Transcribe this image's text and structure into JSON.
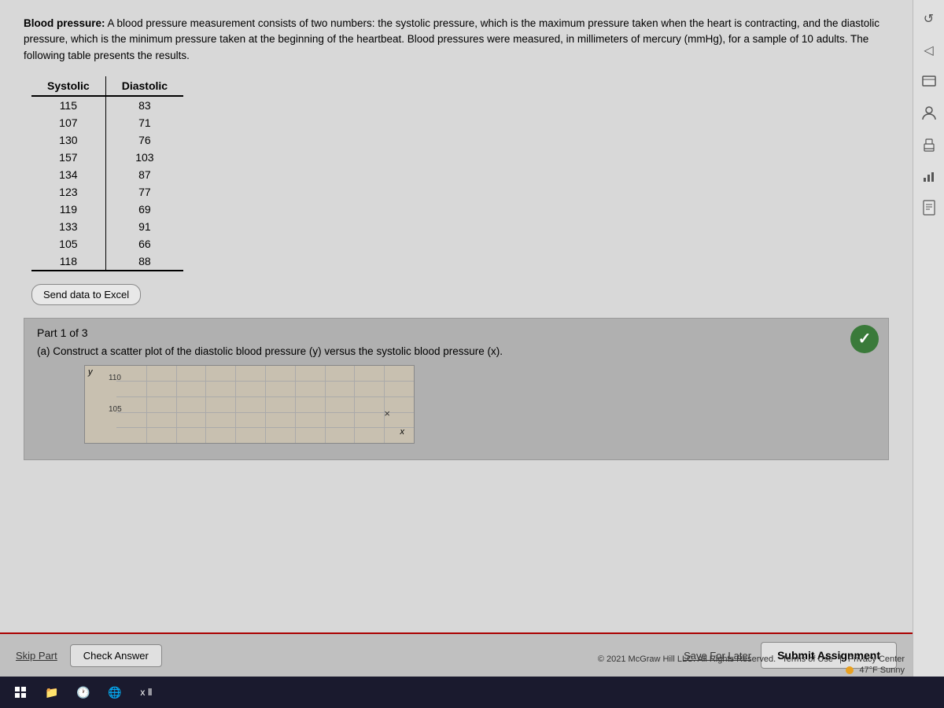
{
  "problem": {
    "intro_bold": "Blood pressure:",
    "intro_text": " A blood pressure measurement consists of two numbers: the systolic pressure, which is the maximum pressure taken when the heart is contracting, and the diastolic pressure, which is the minimum pressure taken at the beginning of the heartbeat. Blood pressures were measured, in millimeters of mercury (mmHg), for a sample of 10 adults. The following table presents the results."
  },
  "table": {
    "headers": [
      "Systolic",
      "Diastolic"
    ],
    "rows": [
      [
        "115",
        "83"
      ],
      [
        "107",
        "71"
      ],
      [
        "130",
        "76"
      ],
      [
        "157",
        "103"
      ],
      [
        "134",
        "87"
      ],
      [
        "123",
        "77"
      ],
      [
        "119",
        "69"
      ],
      [
        "133",
        "91"
      ],
      [
        "105",
        "66"
      ],
      [
        "118",
        "88"
      ]
    ]
  },
  "buttons": {
    "excel": "Send data to Excel",
    "skip_part": "Skip Part",
    "check_answer": "Check Answer",
    "save_later": "Save For Later",
    "submit": "Submit Assignment"
  },
  "part": {
    "label": "Part 1 of 3",
    "question": "(a) Construct a scatter plot of the diastolic blood pressure (y) versus the systolic blood pressure (x)."
  },
  "scatter": {
    "y_ticks": [
      "110",
      "105"
    ],
    "y_label": "y",
    "x_label": "x"
  },
  "footer": {
    "copyright": "© 2021 McGraw Hill LLC. All Rights Reserved.",
    "terms": "Terms of Use",
    "privacy": "Privacy Center",
    "weather": "47°F Sunny"
  },
  "sidebar_icons": [
    {
      "name": "refresh-icon",
      "symbol": "↺"
    },
    {
      "name": "previous-icon",
      "symbol": "◁"
    },
    {
      "name": "person-icon",
      "symbol": "👤"
    },
    {
      "name": "print-icon",
      "symbol": "🖨"
    },
    {
      "name": "chart-icon",
      "symbol": "📊"
    },
    {
      "name": "settings-icon",
      "symbol": "⚙"
    }
  ]
}
